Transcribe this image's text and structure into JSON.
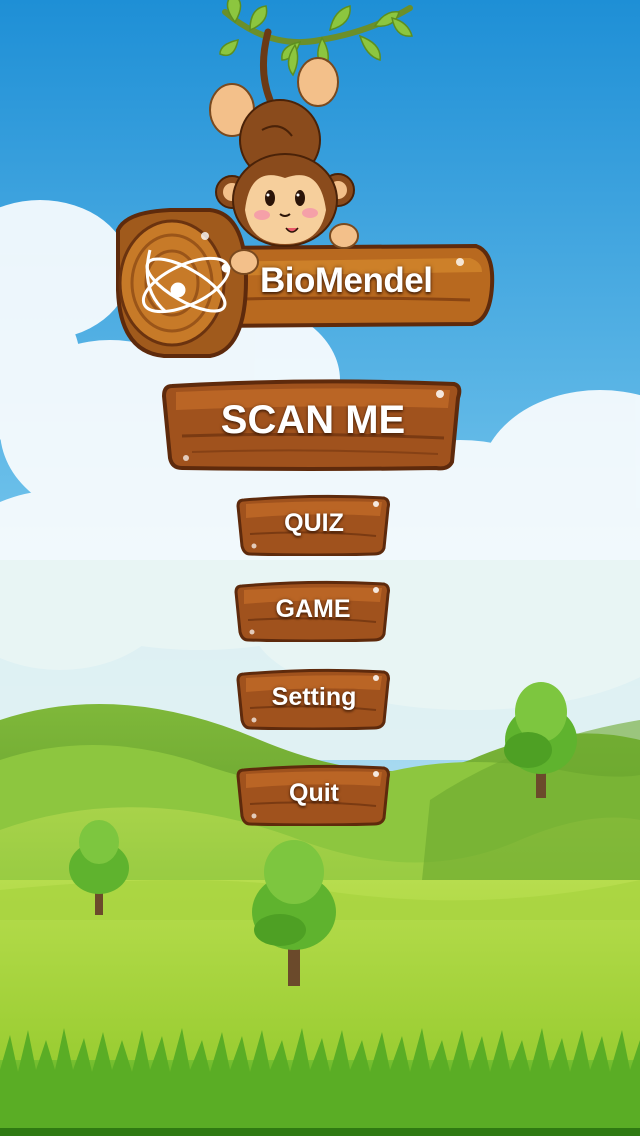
{
  "app": {
    "logo_text": "BioMendel"
  },
  "menu": {
    "scan_label": "SCAN ME",
    "quiz_label": "QUIZ",
    "game_label": "GAME",
    "setting_label": "Setting",
    "quit_label": "Quit"
  },
  "colors": {
    "sky_top": "#1e8fd6",
    "sky_bottom": "#bfe4f2",
    "grass": "#8cc63f",
    "wood": "#a0521d",
    "wood_dark": "#5e2a0c",
    "leaf": "#7cc242"
  }
}
